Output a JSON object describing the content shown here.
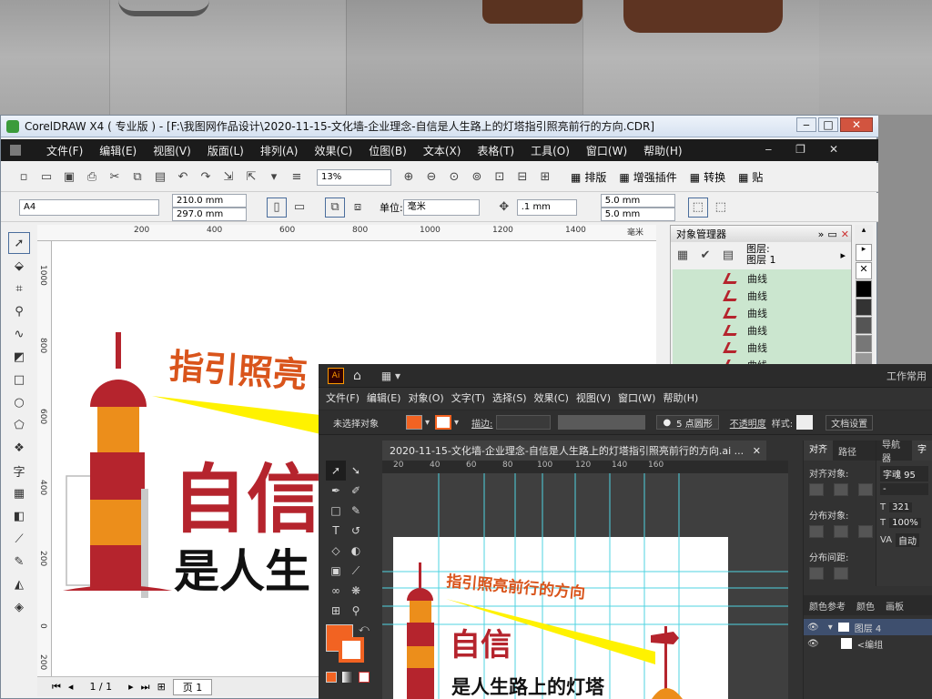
{
  "corel": {
    "title": "CorelDRAW X4 ( 专业版 ) - [F:\\我图网作品设计\\2020-11-15-文化墙-企业理念-自信是人生路上的灯塔指引照亮前行的方向.CDR]",
    "menu": [
      "文件(F)",
      "编辑(E)",
      "视图(V)",
      "版面(L)",
      "排列(A)",
      "效果(C)",
      "位图(B)",
      "文本(X)",
      "表格(T)",
      "工具(O)",
      "窗口(W)",
      "帮助(H)"
    ],
    "zoom": "13%",
    "plugins": {
      "layout": "排版",
      "enhance": "增强插件",
      "convert": "转换",
      "paste": "贴"
    },
    "page_size": "A4",
    "width": "210.0 mm",
    "height": "297.0 mm",
    "unit_label": "单位:",
    "unit_value": "毫米",
    "nudge": ".1 mm",
    "dup_x": "5.0 mm",
    "dup_y": "5.0 mm",
    "ruler_top": [
      "200",
      "400",
      "600",
      "800",
      "1000",
      "1200",
      "1400",
      "毫米"
    ],
    "ruler_left": [
      "1000",
      "800",
      "600",
      "400",
      "200",
      "0",
      "200"
    ],
    "status": {
      "page_count": "1 / 1",
      "page_tab": "页 1"
    },
    "object_manager": {
      "title": "对象管理器",
      "layer_label": "图层:",
      "layer_name": "图层 1",
      "items": [
        "曲线",
        "曲线",
        "曲线",
        "曲线",
        "曲线",
        "曲线"
      ]
    },
    "art": {
      "slogan": "指引照亮",
      "headline": "自信",
      "subline": "是人生"
    }
  },
  "ai": {
    "workspace": "工作常用",
    "menu": [
      "文件(F)",
      "编辑(E)",
      "对象(O)",
      "文字(T)",
      "选择(S)",
      "效果(C)",
      "视图(V)",
      "窗口(W)",
      "帮助(H)"
    ],
    "no_selection": "未选择对象",
    "stroke_label": "描边:",
    "brush": "5 点圆形",
    "opacity_label": "不透明度",
    "style_label": "样式:",
    "doc_settings": "文档设置",
    "doc_tab": "2020-11-15-文化墙-企业理念-自信是人生路上的灯塔指引照亮前行的方向.ai ...",
    "ruler": [
      "20",
      "40",
      "60",
      "80",
      "100",
      "120",
      "140",
      "160"
    ],
    "panel": {
      "tabs": [
        "对齐",
        "路径",
        "导航器",
        "字"
      ],
      "align_label": "对齐对象:",
      "distribute_label": "分布对象:",
      "spacing_label": "分布间距:",
      "layer_tabs": [
        "颜色参考",
        "颜色",
        "画板"
      ],
      "layer_name": "图层 4",
      "group_name": "<编组"
    },
    "char": {
      "font": "字魂 95",
      "dash": "-",
      "size": "321",
      "scale": "100%",
      "auto": "自动"
    },
    "art": {
      "slogan": "指引照亮前行的方向",
      "headline": "自信",
      "subline": "是人生路上的灯塔"
    }
  },
  "colors": {
    "brand_red": "#b5242d",
    "brand_orange": "#ec8e1b",
    "slogan_orange": "#d9541b",
    "beam_yellow": "#fff200",
    "ai_fill": "#f26322"
  }
}
